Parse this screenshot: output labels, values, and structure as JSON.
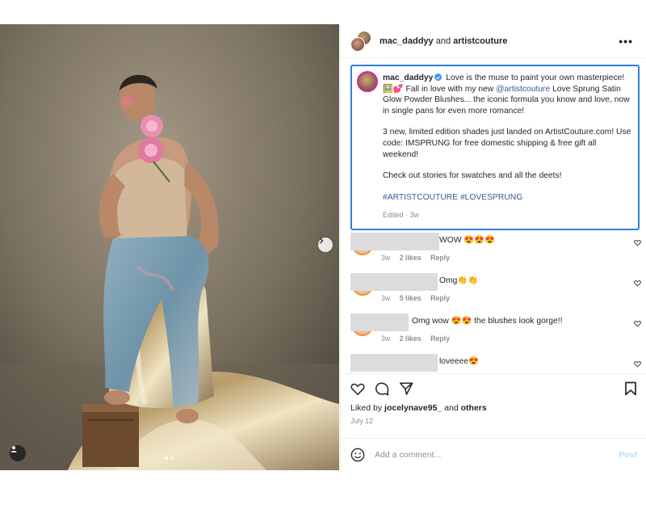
{
  "post": {
    "header_user1": "mac_daddyy",
    "header_and": "and",
    "header_user2": "artistcouture",
    "more_label": "•••"
  },
  "caption": {
    "username": "mac_daddyy",
    "line1_a": "Love is the muse to paint your own masterpiece! 🖼️💕 Fall in love with my new ",
    "mention": "@artistcouture",
    "line1_b": " Love Sprung Satin Glow Powder Blushes... the iconic formula you know and love, now in single pans for even more romance!",
    "para2": "3 new, limited edition shades just landed on ArtistCouture.com! Use code: IMSPRUNG for free domestic shipping & free gift all weekend!",
    "para3": "Check out stories for swatches and all the deets!",
    "hashtag1": "#ARTISTCOUTURE",
    "hashtag2": "#LOVESPRUNG",
    "edited": "Edited · 3w"
  },
  "comments": [
    {
      "text": "WOW 😍😍😍",
      "time": "3w",
      "likes": "2 likes",
      "reply": "Reply"
    },
    {
      "text": "Omg👏👏",
      "time": "3w",
      "likes": "5 likes",
      "reply": "Reply"
    },
    {
      "text": "Omg wow 😍😍 the blushes look gorge!!",
      "time": "3w",
      "likes": "2 likes",
      "reply": "Reply"
    },
    {
      "text": "loveeee😍",
      "time": "",
      "likes": "",
      "reply": ""
    }
  ],
  "likes": {
    "prefix": "Liked by",
    "user": "jocelynave95_",
    "and": "and",
    "others": "others"
  },
  "date": "July 12",
  "add_comment": {
    "placeholder": "Add a comment...",
    "post_label": "Post"
  },
  "icons": {
    "next": "chevron-right-icon",
    "tag": "user-tag-icon",
    "heart": "heart-icon",
    "comment": "comment-icon",
    "share": "share-icon",
    "save": "bookmark-icon",
    "emoji": "emoji-icon"
  },
  "colors": {
    "caption_highlight": "#2f7fe0",
    "link": "#385898",
    "post_disabled": "#b2dffc"
  }
}
